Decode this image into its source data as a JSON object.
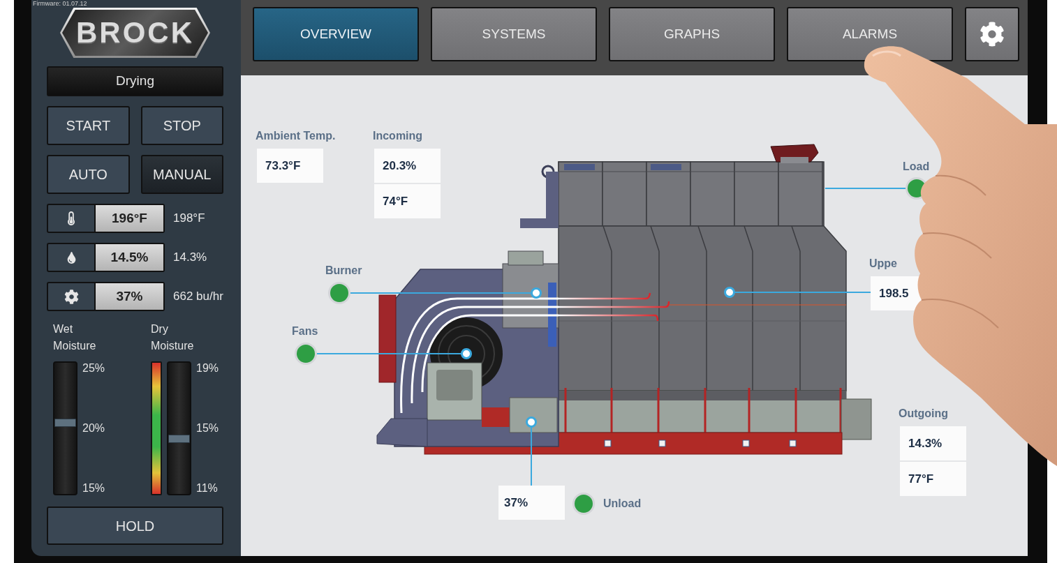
{
  "firmware": "Firmware: 01.07.12",
  "logo": {
    "text": "BROCK"
  },
  "status": "Drying",
  "control_buttons": [
    {
      "label": "START"
    },
    {
      "label": "STOP"
    }
  ],
  "mode_buttons": [
    {
      "label": "AUTO",
      "selected": false
    },
    {
      "label": "MANUAL",
      "selected": true
    }
  ],
  "readouts": [
    {
      "kind": "temperature",
      "value": "196°F",
      "reading": "198°F"
    },
    {
      "kind": "moisture",
      "value": "14.5%",
      "reading": "14.3%"
    },
    {
      "kind": "rate",
      "value": "37%",
      "reading": "662 bu/hr"
    }
  ],
  "moisture_sliders": [
    {
      "label": "Wet Moisture",
      "ticks": [
        "25%",
        "20%",
        "15%"
      ],
      "level": 0.54,
      "color_scale": false
    },
    {
      "label": "Dry Moisture",
      "ticks": [
        "19%",
        "15%",
        "11%"
      ],
      "level": 0.42,
      "color_scale": true
    }
  ],
  "hold_button": {
    "label": "HOLD"
  },
  "tabs": [
    {
      "label": "OVERVIEW",
      "selected": true
    },
    {
      "label": "SYSTEMS",
      "selected": false
    },
    {
      "label": "GRAPHS",
      "selected": false
    },
    {
      "label": "ALARMS",
      "selected": false
    }
  ],
  "readings": [
    {
      "label": "Ambient Temp.",
      "values": [
        "73.3°F"
      ]
    },
    {
      "label": "Incoming",
      "values": [
        "20.3%",
        "74°F"
      ]
    },
    {
      "label": "Uppe",
      "values": [
        "198.5"
      ]
    },
    {
      "label": "Outgoing",
      "values": [
        "14.3%",
        "77°F"
      ]
    }
  ],
  "indicators": [
    {
      "label": "Burner",
      "color": "#2e9e44"
    },
    {
      "label": "Fans",
      "color": "#2e9e44"
    },
    {
      "label": "Load",
      "color": "#2e9e44"
    },
    {
      "label": "Unload",
      "color": "#2e9e44"
    }
  ],
  "unload_value": "37%"
}
